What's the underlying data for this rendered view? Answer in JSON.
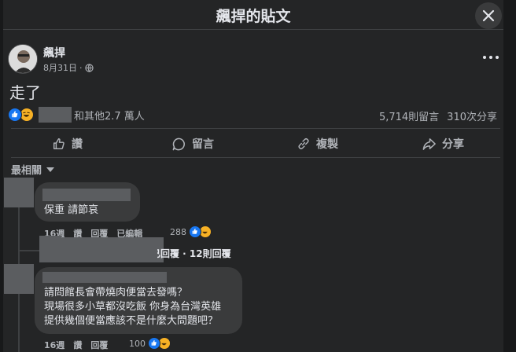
{
  "header": {
    "title": "飆捍的貼文"
  },
  "post": {
    "author": "飆捍",
    "date": "8月31日",
    "dot": "·",
    "text": "走了",
    "reactions_text": "和其他2.7 萬人",
    "comments_count": "5,714則留言",
    "shares_count": "310次分享"
  },
  "actions": {
    "like": "讚",
    "comment": "留言",
    "copy": "複製",
    "share": "分享"
  },
  "sort": {
    "label": "最相關"
  },
  "comments": [
    {
      "lines": [
        "保重 請節哀"
      ],
      "time": "16週",
      "like": "讚",
      "reply": "回覆",
      "edited": "已編輯",
      "reaction_count": "288",
      "replies_summary": "已回覆 · 12則回覆"
    },
    {
      "lines": [
        "請問館長會帶燒肉便當去發嗎？",
        "現場很多小草都沒吃飯 你身為台灣英雄",
        "提供幾個便當應該不是什麼大問題吧？"
      ],
      "time": "16週",
      "like": "讚",
      "reply": "回覆",
      "reaction_count": "100"
    }
  ],
  "colors": {
    "like_blue": "#1877f2",
    "haha_yellow": "#f7b125",
    "background": "#242526",
    "bubble": "#3a3b3c"
  },
  "icons": [
    "close-icon",
    "globe-icon",
    "more-icon",
    "like-icon",
    "comment-icon",
    "link-icon",
    "share-icon",
    "caret-down-icon"
  ]
}
